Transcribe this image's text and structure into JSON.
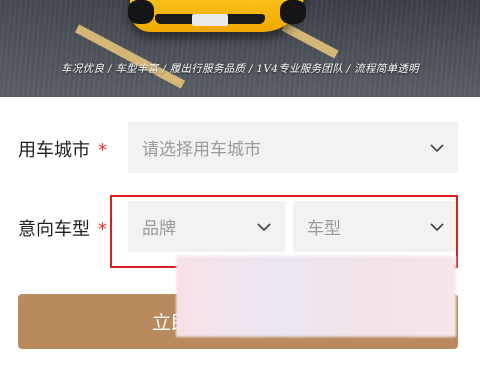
{
  "hero": {
    "tagline": "车况优良 / 车型丰富 / 履出行服务品质 / 1V4专业服务团队 / 流程简单透明",
    "plate_text": ""
  },
  "form": {
    "city": {
      "label": "用车城市",
      "required_mark": "*",
      "placeholder": "请选择用车城市"
    },
    "model": {
      "label": "意向车型",
      "required_mark": "*",
      "brand_placeholder": "品牌",
      "type_placeholder": "车型"
    },
    "submit_label": "立即"
  },
  "colors": {
    "accent": "#b98a5e",
    "required": "#e23a2e",
    "highlight": "#d62020",
    "select_bg": "#f2f2f2"
  },
  "icons": {
    "dropdown": "chevron-down-icon"
  }
}
